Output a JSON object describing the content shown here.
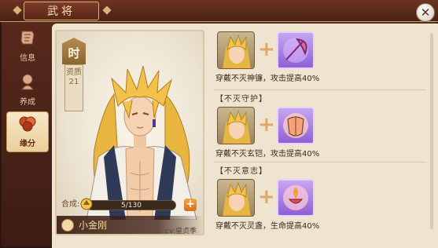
{
  "window": {
    "title": "武将"
  },
  "nav": {
    "items": [
      {
        "label": "信息",
        "icon": "scroll-icon",
        "active": false
      },
      {
        "label": "养成",
        "icon": "cultivate-icon",
        "active": false
      },
      {
        "label": "缘分",
        "icon": "fate-icon",
        "active": true
      }
    ]
  },
  "hero": {
    "faction": "时",
    "aptitude_label": "资质",
    "aptitude_value": "21",
    "compose_label": "合成:",
    "compose_value": "5/130",
    "compose_progress": 0.04,
    "name": "小金刚",
    "cv": "cv:皇贞季"
  },
  "fates": [
    {
      "title": "",
      "desc": "穿戴不灭神镰，攻击提高40%"
    },
    {
      "title": "【不灭守护】",
      "desc": "穿戴不灭玄铠，攻击提高40%"
    },
    {
      "title": "【不灭意志】",
      "desc": "穿戴不灭灵盏，生命提高40%"
    }
  ],
  "colors": {
    "accent": "#d66f18",
    "panel": "#efe4d0",
    "frame": "#5a2a1c",
    "gold": "#d9b27a"
  }
}
